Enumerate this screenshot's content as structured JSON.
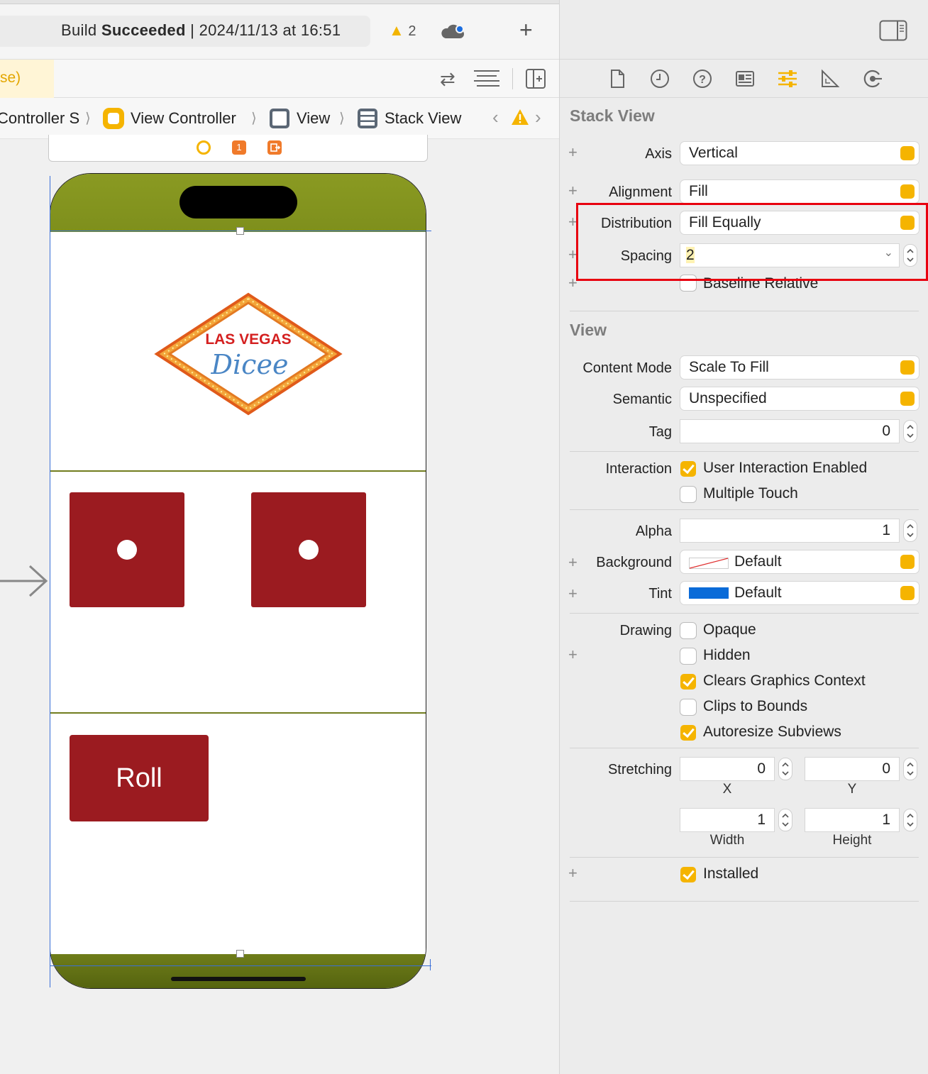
{
  "toolbar": {
    "status_prefix": "Build",
    "status_bold": "Succeeded",
    "status_suffix": "| 2024/11/13 at 16:51",
    "warning_count": "2"
  },
  "editor": {
    "release_tab": "se)"
  },
  "breadcrumb": {
    "items": [
      "Controller S",
      "View Controller",
      "View",
      "Stack View"
    ]
  },
  "dock": {
    "badge": "1"
  },
  "canvas": {
    "logo_line1": "LAS VEGAS",
    "logo_line2": "Dicee",
    "roll_button": "Roll"
  },
  "inspector": {
    "stack_view": {
      "title": "Stack View",
      "axis_label": "Axis",
      "axis_value": "Vertical",
      "alignment_label": "Alignment",
      "alignment_value": "Fill",
      "distribution_label": "Distribution",
      "distribution_value": "Fill Equally",
      "spacing_label": "Spacing",
      "spacing_value": "2",
      "baseline_label": "Baseline Relative"
    },
    "view": {
      "title": "View",
      "content_mode_label": "Content Mode",
      "content_mode_value": "Scale To Fill",
      "semantic_label": "Semantic",
      "semantic_value": "Unspecified",
      "tag_label": "Tag",
      "tag_value": "0",
      "interaction_label": "Interaction",
      "user_interaction": "User Interaction Enabled",
      "multiple_touch": "Multiple Touch",
      "alpha_label": "Alpha",
      "alpha_value": "1",
      "background_label": "Background",
      "background_value": "Default",
      "tint_label": "Tint",
      "tint_value": "Default",
      "drawing_label": "Drawing",
      "opaque": "Opaque",
      "hidden": "Hidden",
      "clears_graphics": "Clears Graphics Context",
      "clips_bounds": "Clips to Bounds",
      "autoresize": "Autoresize Subviews",
      "stretching_label": "Stretching",
      "stretch_x": "0",
      "stretch_y": "0",
      "stretch_w": "1",
      "stretch_h": "1",
      "x_label": "X",
      "y_label": "Y",
      "width_label": "Width",
      "height_label": "Height",
      "installed": "Installed"
    }
  },
  "colors": {
    "accent": "#f5b400",
    "dice_red": "#9b1b20",
    "highlight_red": "#e8000f",
    "tint_blue": "#0a6bd8"
  }
}
